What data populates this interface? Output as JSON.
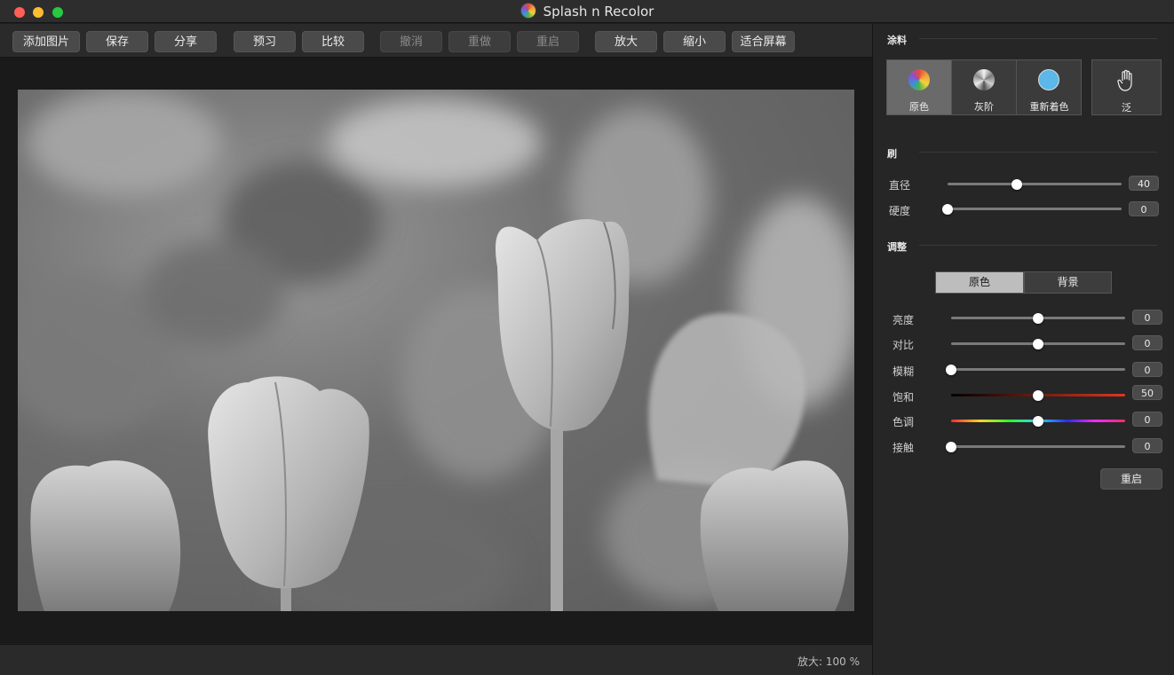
{
  "window": {
    "title": "Splash n Recolor"
  },
  "toolbar": {
    "add_image": "添加图片",
    "save": "保存",
    "share": "分享",
    "preview": "预习",
    "compare": "比较",
    "undo": "撤消",
    "redo": "重做",
    "restart": "重启",
    "zoom_in": "放大",
    "zoom_out": "缩小",
    "fit_screen": "适合屏幕"
  },
  "status": {
    "zoom": "放大: 100 %"
  },
  "panel": {
    "paint": {
      "title": "涂料",
      "modes": [
        {
          "label": "原色",
          "icon": "color-wheel-icon",
          "active": true
        },
        {
          "label": "灰阶",
          "icon": "grayscale-wheel-icon",
          "active": false
        },
        {
          "label": "重新着色",
          "icon": "blue-circle-icon",
          "active": false
        }
      ],
      "pan_label": "泛",
      "pan_icon": "hand-icon"
    },
    "brush": {
      "title": "刷",
      "diameter": {
        "label": "直径",
        "value": "40",
        "level": 0.4
      },
      "hardness": {
        "label": "硬度",
        "value": "0",
        "level": 0.0
      }
    },
    "adjust": {
      "title": "调整",
      "tabs": [
        {
          "label": "原色",
          "active": true
        },
        {
          "label": "背景",
          "active": false
        }
      ],
      "sliders": [
        {
          "label": "亮度",
          "value": "0",
          "level": 0.5,
          "track": "plain"
        },
        {
          "label": "对比",
          "value": "0",
          "level": 0.5,
          "track": "plain"
        },
        {
          "label": "模糊",
          "value": "0",
          "level": 0.0,
          "track": "plain"
        },
        {
          "label": "饱和",
          "value": "50",
          "level": 0.5,
          "track": "saturation"
        },
        {
          "label": "色调",
          "value": "0",
          "level": 0.5,
          "track": "hue"
        },
        {
          "label": "接触",
          "value": "0",
          "level": 0.0,
          "track": "plain"
        }
      ],
      "reset_label": "重启"
    }
  },
  "colors": {
    "window_bg": "#1e1e1e",
    "panel_bg": "#262626",
    "active_mode": "#6a6a6a",
    "recolor_swatch": "#5bb8e8"
  }
}
